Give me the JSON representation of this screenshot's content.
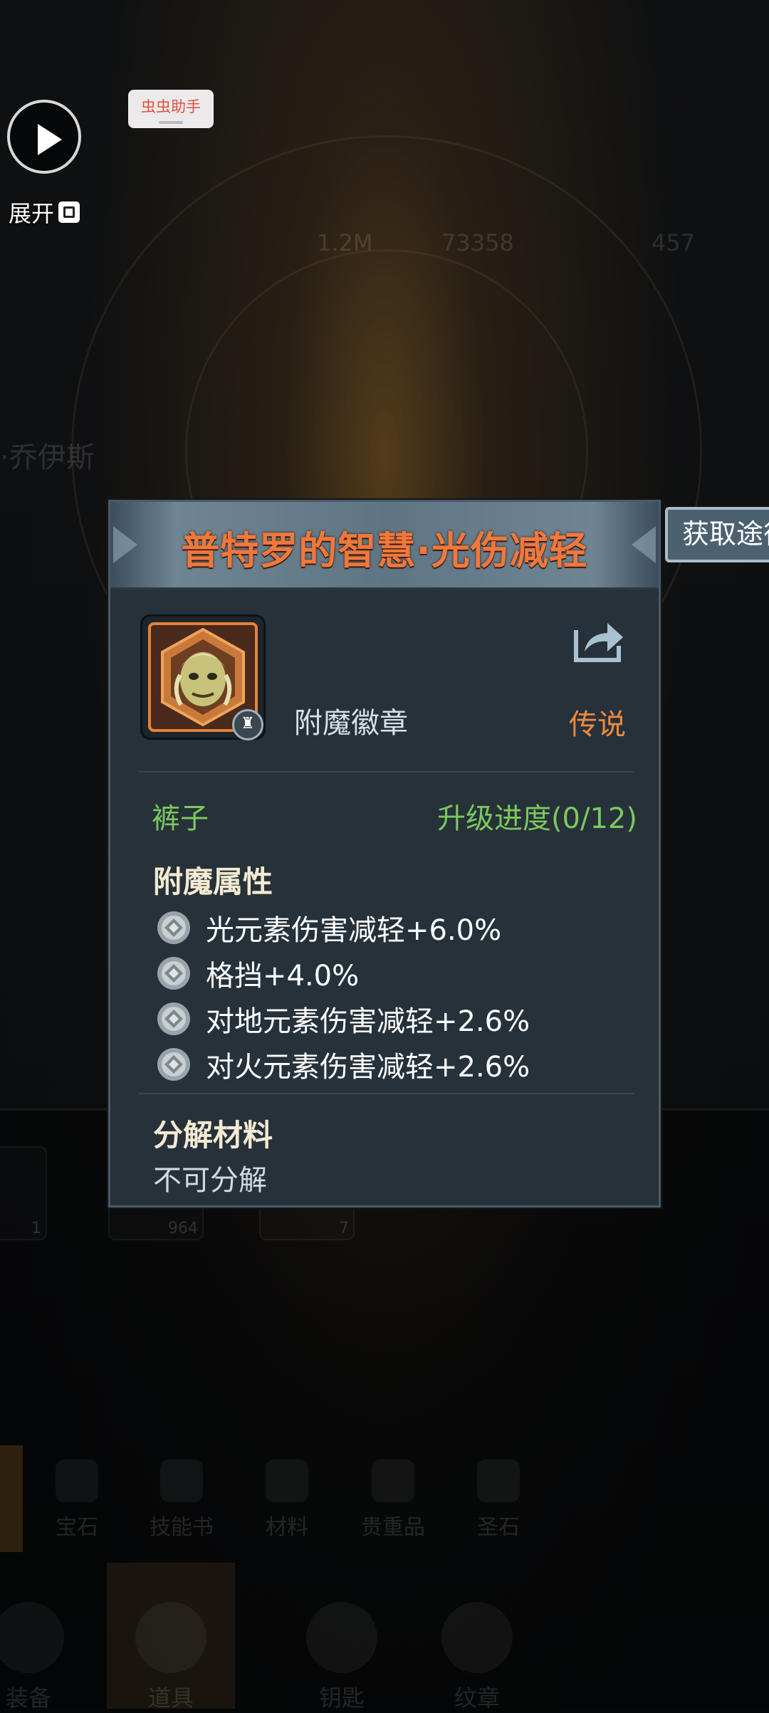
{
  "background": {
    "stat_values": [
      "1.2M",
      "73358",
      "457"
    ],
    "character_name": "·乔伊斯",
    "slot_counts": [
      "1",
      "964",
      "7"
    ],
    "category_tabs": [
      "宝石",
      "技能书",
      "材料",
      "贵重品",
      "圣石"
    ],
    "bottom_nav": [
      "装备",
      "道具",
      "钥匙",
      "纹章"
    ]
  },
  "float_widget": {
    "play_icon": "play-icon",
    "expand_label": "展开",
    "expand_icon": "expand-icon"
  },
  "helper_badge": {
    "label": "虫虫助手"
  },
  "panel": {
    "title": "普特罗的智慧·光伤减轻",
    "item_type": "附魔徽章",
    "rarity": "传说",
    "slot": "裤子",
    "upgrade_progress": "升级进度(0/12)",
    "enchant_section_title": "附魔属性",
    "attributes": [
      {
        "icon": "attribute-diamond-icon",
        "text": "光元素伤害减轻+6.0%"
      },
      {
        "icon": "attribute-diamond-icon",
        "text": "格挡+4.0%"
      },
      {
        "icon": "attribute-diamond-icon",
        "text": "对地元素伤害减轻+2.6%"
      },
      {
        "icon": "attribute-diamond-icon",
        "text": "对火元素伤害减轻+2.6%"
      }
    ],
    "decompose_title": "分解材料",
    "decompose_value": "不可分解",
    "share_icon": "share-icon"
  },
  "acquire_tab": {
    "label": "获取途径"
  },
  "colors": {
    "title_orange": "#f0783c",
    "rarity_orange": "#f08a3c",
    "green": "#7cc85c",
    "panel_bg": "#26313a"
  }
}
